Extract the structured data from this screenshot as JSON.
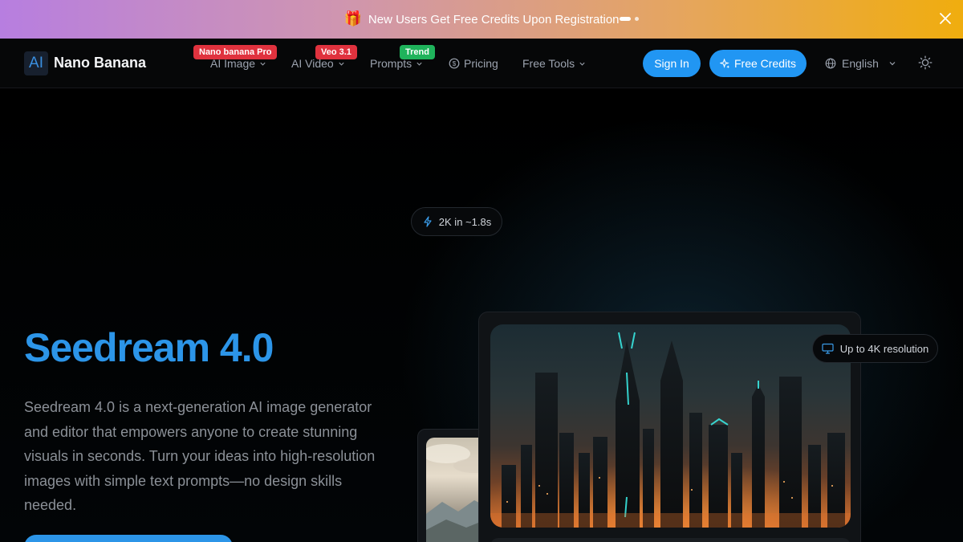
{
  "promo": {
    "gift_icon": "gift-icon",
    "text": "New Users Get Free Credits Upon Registration"
  },
  "nav": {
    "logo_mark": "AI",
    "logo_text": "Nano Banana",
    "items": [
      {
        "label": "AI Image",
        "badge": "Nano banana Pro",
        "badge_color": "#e0323e",
        "has_dropdown": true
      },
      {
        "label": "AI Video",
        "badge": "Veo 3.1",
        "badge_color": "#e0323e",
        "has_dropdown": true
      },
      {
        "label": "Prompts",
        "badge": "Trend",
        "badge_color": "#1fb35b",
        "has_dropdown": true
      },
      {
        "label": "Pricing",
        "icon": "dollar-circle-icon",
        "has_dropdown": false
      },
      {
        "label": "Free Tools",
        "has_dropdown": true
      }
    ],
    "sign_in": "Sign In",
    "free_credits": "Free Credits",
    "language": "English"
  },
  "hero": {
    "speed_pill": "2K in ~1.8s",
    "title": "Seedream 4.0",
    "description": "Seedream 4.0 is a next-generation AI image generator and editor that empowers anyone to create stunning visuals in seconds. Turn your ideas into high-resolution images with simple text prompts—no design skills needed.",
    "resolution_pill": "Up to 4K resolution"
  },
  "colors": {
    "accent": "#2c95e8",
    "button": "#2196f3"
  }
}
